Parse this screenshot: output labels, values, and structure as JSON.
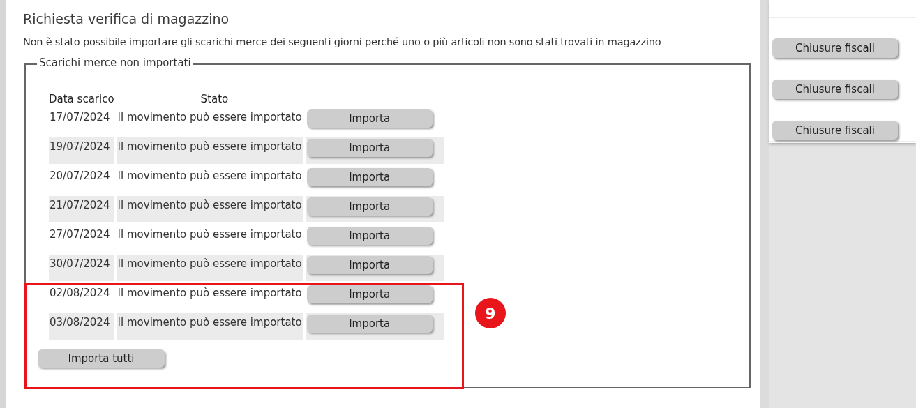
{
  "title": "Richiesta verifica di magazzino",
  "message": "Non è stato possibile importare gli scarichi merce dei seguenti giorni perché uno o più articoli non sono stati trovati in magazzino",
  "group": {
    "legend": "Scarichi merce non importati",
    "columns": [
      "Data scarico",
      "Stato"
    ],
    "rows": [
      {
        "date": "17/07/2024",
        "status": "Il movimento può essere importato",
        "button": "Importa"
      },
      {
        "date": "19/07/2024",
        "status": "Il movimento può essere importato",
        "button": "Importa"
      },
      {
        "date": "20/07/2024",
        "status": "Il movimento può essere importato",
        "button": "Importa"
      },
      {
        "date": "21/07/2024",
        "status": "Il movimento può essere importato",
        "button": "Importa"
      },
      {
        "date": "27/07/2024",
        "status": "Il movimento può essere importato",
        "button": "Importa"
      },
      {
        "date": "30/07/2024",
        "status": "Il movimento può essere importato",
        "button": "Importa"
      },
      {
        "date": "02/08/2024",
        "status": "Il movimento può essere importato",
        "button": "Importa"
      },
      {
        "date": "03/08/2024",
        "status": "Il movimento può essere importato",
        "button": "Importa"
      }
    ],
    "import_all": "Importa tutti"
  },
  "callout": {
    "number": "9"
  },
  "side_panel": {
    "buttons": [
      "Chiusure fiscali",
      "Chiusure fiscali",
      "Chiusure fiscali"
    ]
  }
}
